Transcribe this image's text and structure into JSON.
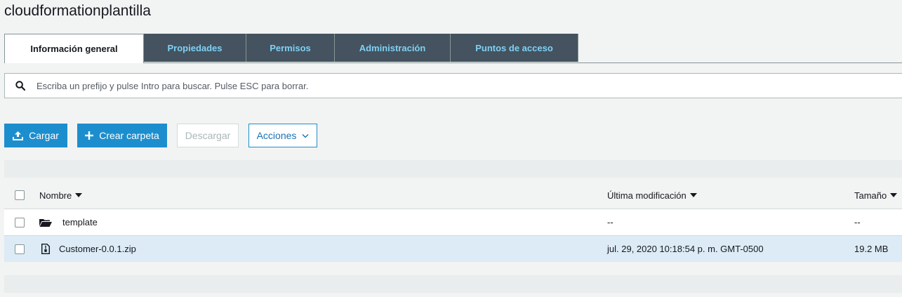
{
  "page": {
    "title": "cloudformationplantilla"
  },
  "tabs": [
    {
      "label": "Información general",
      "active": true
    },
    {
      "label": "Propiedades",
      "active": false
    },
    {
      "label": "Permisos",
      "active": false
    },
    {
      "label": "Administración",
      "active": false
    },
    {
      "label": "Puntos de acceso",
      "active": false
    }
  ],
  "search": {
    "placeholder": "Escriba un prefijo y pulse Intro para buscar. Pulse ESC para borrar.",
    "value": ""
  },
  "toolbar": {
    "upload_label": "Cargar",
    "create_folder_label": "Crear carpeta",
    "download_label": "Descargar",
    "actions_label": "Acciones"
  },
  "table": {
    "columns": {
      "name": "Nombre",
      "modified": "Última modificación",
      "size": "Tamaño"
    },
    "rows": [
      {
        "type": "folder",
        "icon": "folder-icon",
        "name": "template",
        "modified": "--",
        "size": "--",
        "selected": false
      },
      {
        "type": "file",
        "icon": "zip-file-icon",
        "name": "Customer-0.0.1.zip",
        "modified": "jul. 29, 2020 10:18:54 p. m. GMT-0500",
        "size": "19.2 MB",
        "selected": true
      }
    ]
  },
  "colors": {
    "tab_dark_bg": "#44535f",
    "tab_text": "#7fd0f5",
    "primary": "#1d8ecd",
    "selected_row": "#dcebf6"
  }
}
